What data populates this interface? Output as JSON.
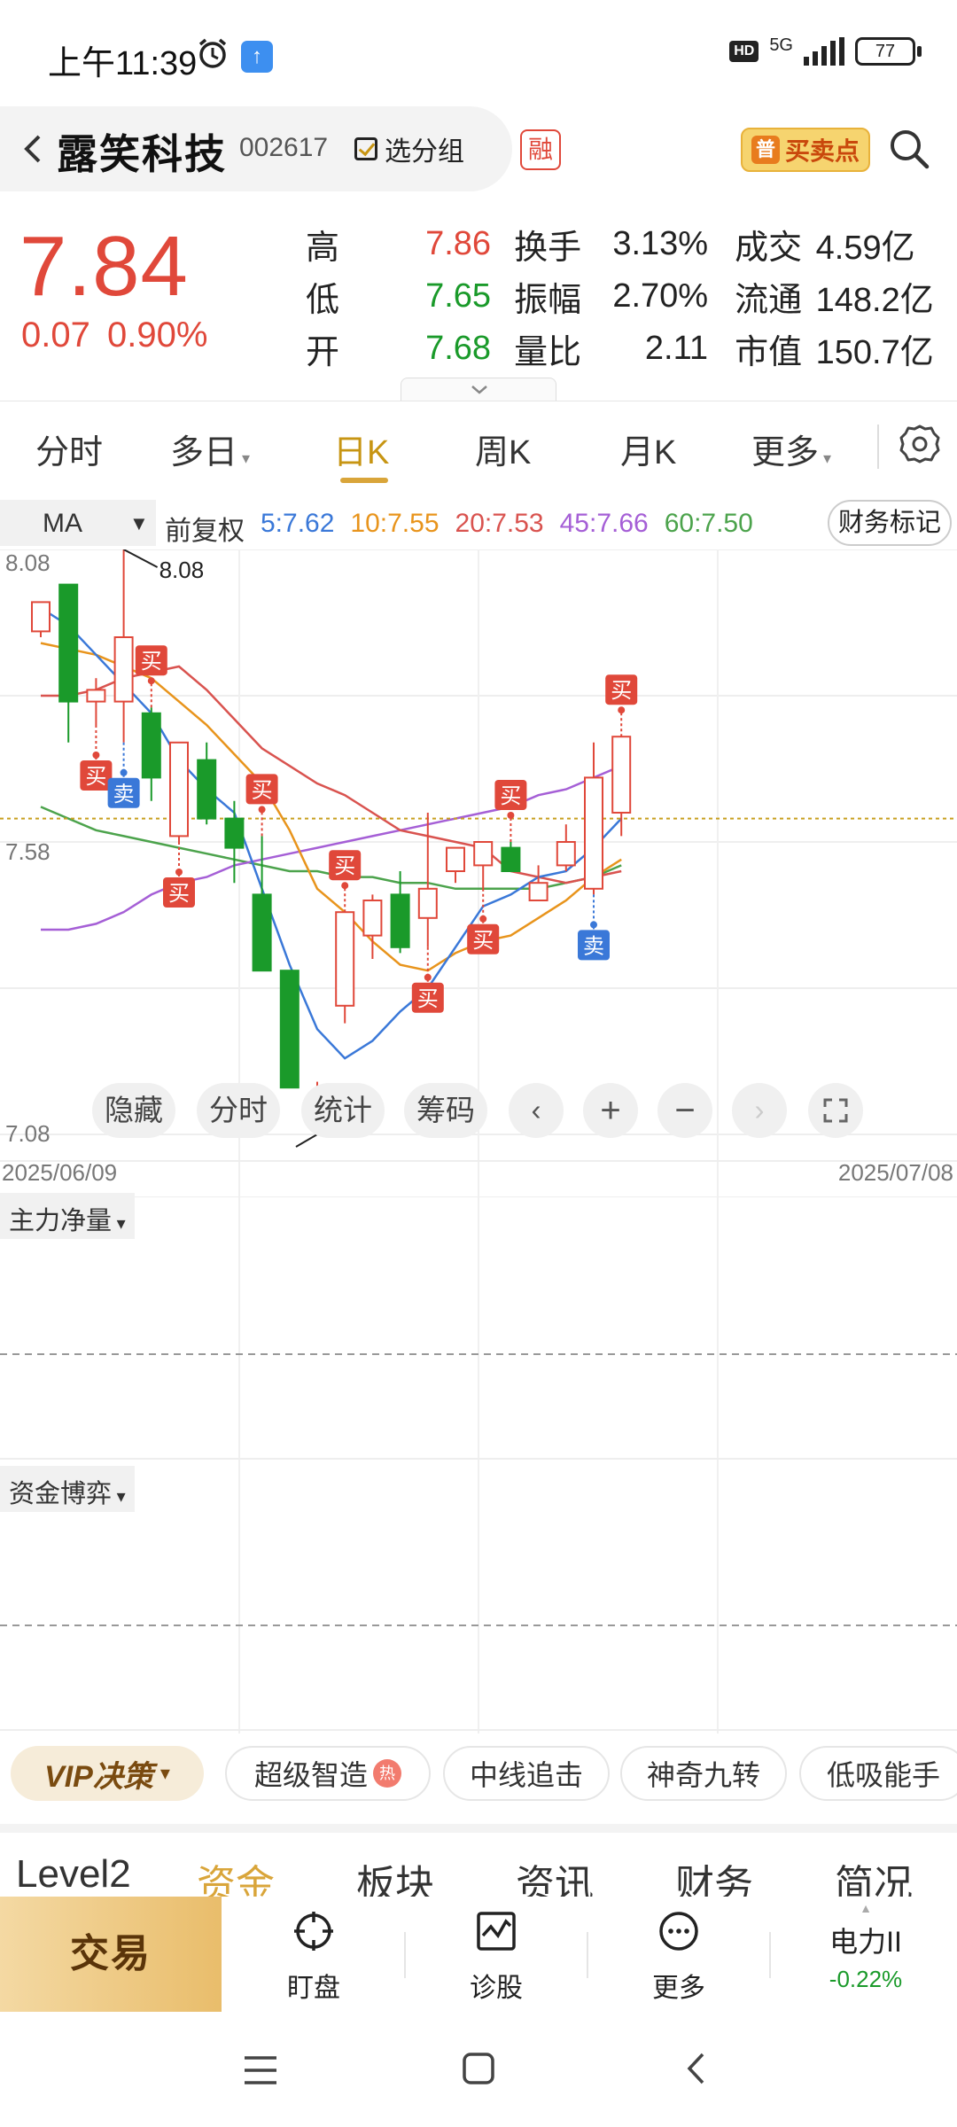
{
  "status": {
    "time": "上午11:39",
    "net": "5G",
    "hd": "HD",
    "battery": "77"
  },
  "header": {
    "name": "露笑科技",
    "code": "002617",
    "group_label": "选分组",
    "margin_badge": "融",
    "buysell_label": "买卖点",
    "buysell_badge": "普"
  },
  "quote": {
    "price": "7.84",
    "change": "0.07",
    "change_pct": "0.90%",
    "rows": [
      {
        "l1": "高",
        "v1": "7.86",
        "l2": "换手",
        "v2": "3.13%",
        "l3": "成交",
        "v3": "4.59亿"
      },
      {
        "l1": "低",
        "v1": "7.65",
        "l2": "振幅",
        "v2": "2.70%",
        "l3": "流通",
        "v3": "148.2亿"
      },
      {
        "l1": "开",
        "v1": "7.68",
        "l2": "量比",
        "v2": "2.11",
        "l3": "市值",
        "v3": "150.7亿"
      }
    ]
  },
  "period_tabs": [
    "分时",
    "多日",
    "日K",
    "周K",
    "月K",
    "更多"
  ],
  "active_period": "日K",
  "ma": {
    "selector": "MA",
    "adjust": "前复权",
    "items": [
      {
        "label": "5:7.62",
        "color": "#3a78d8"
      },
      {
        "label": "10:7.55",
        "color": "#e8941c"
      },
      {
        "label": "20:7.53",
        "color": "#d9534f"
      },
      {
        "label": "45:7.66",
        "color": "#a55fd6"
      },
      {
        "label": "60:7.50",
        "color": "#4ca34c"
      }
    ],
    "fin_mark": "财务标记"
  },
  "chart_data": {
    "type": "candlestick",
    "x_start": "2025/06/09",
    "x_end": "2025/07/08",
    "y_top_label": "8.08",
    "y_mid_label": "7.58",
    "y_bottom_label": "7.08",
    "high_marker": "8.08",
    "low_marker": "7.08",
    "ylim": [
      7.08,
      8.08
    ],
    "current_price_line": 7.62,
    "candles": [
      {
        "o": 7.94,
        "h": 7.99,
        "l": 7.93,
        "c": 7.99
      },
      {
        "o": 8.02,
        "h": 8.02,
        "l": 7.75,
        "c": 7.82
      },
      {
        "o": 7.82,
        "h": 7.86,
        "l": 7.78,
        "c": 7.84
      },
      {
        "o": 7.82,
        "h": 8.08,
        "l": 7.75,
        "c": 7.93
      },
      {
        "o": 7.8,
        "h": 7.81,
        "l": 7.65,
        "c": 7.69
      },
      {
        "o": 7.59,
        "h": 7.73,
        "l": 7.58,
        "c": 7.75
      },
      {
        "o": 7.72,
        "h": 7.75,
        "l": 7.61,
        "c": 7.62
      },
      {
        "o": 7.62,
        "h": 7.65,
        "l": 7.51,
        "c": 7.57
      },
      {
        "o": 7.49,
        "h": 7.59,
        "l": 7.42,
        "c": 7.36
      },
      {
        "o": 7.36,
        "h": 7.32,
        "l": 7.16,
        "c": 7.16
      },
      {
        "o": 7.11,
        "h": 7.17,
        "l": 7.08,
        "c": 7.14
      },
      {
        "o": 7.3,
        "h": 7.42,
        "l": 7.27,
        "c": 7.46
      },
      {
        "o": 7.42,
        "h": 7.49,
        "l": 7.38,
        "c": 7.48
      },
      {
        "o": 7.49,
        "h": 7.53,
        "l": 7.39,
        "c": 7.4
      },
      {
        "o": 7.45,
        "h": 7.63,
        "l": 7.4,
        "c": 7.5
      },
      {
        "o": 7.53,
        "h": 7.56,
        "l": 7.51,
        "c": 7.57
      },
      {
        "o": 7.54,
        "h": 7.57,
        "l": 7.5,
        "c": 7.58
      },
      {
        "o": 7.57,
        "h": 7.58,
        "l": 7.53,
        "c": 7.53
      },
      {
        "o": 7.48,
        "h": 7.54,
        "l": 7.48,
        "c": 7.51
      },
      {
        "o": 7.54,
        "h": 7.61,
        "l": 7.53,
        "c": 7.58
      },
      {
        "o": 7.5,
        "h": 7.75,
        "l": 7.49,
        "c": 7.69
      },
      {
        "o": 7.63,
        "h": 7.76,
        "l": 7.59,
        "c": 7.76
      }
    ],
    "ma5": [
      7.98,
      7.95,
      7.9,
      7.85,
      7.8,
      7.72,
      7.67,
      7.63,
      7.5,
      7.37,
      7.26,
      7.21,
      7.24,
      7.29,
      7.33,
      7.4,
      7.47,
      7.49,
      7.52,
      7.53,
      7.57,
      7.62
    ],
    "ma10": [
      7.92,
      7.91,
      7.9,
      7.88,
      7.86,
      7.82,
      7.78,
      7.73,
      7.68,
      7.6,
      7.5,
      7.46,
      7.41,
      7.37,
      7.36,
      7.39,
      7.41,
      7.42,
      7.45,
      7.48,
      7.52,
      7.55
    ],
    "ma20": [
      7.83,
      7.83,
      7.84,
      7.86,
      7.87,
      7.88,
      7.84,
      7.79,
      7.74,
      7.71,
      7.68,
      7.66,
      7.63,
      7.6,
      7.59,
      7.58,
      7.57,
      7.53,
      7.52,
      7.51,
      7.52,
      7.53
    ],
    "ma45": [
      7.43,
      7.43,
      7.44,
      7.46,
      7.49,
      7.51,
      7.52,
      7.54,
      7.55,
      7.56,
      7.57,
      7.58,
      7.59,
      7.6,
      7.61,
      7.62,
      7.63,
      7.64,
      7.66,
      7.67,
      7.69,
      7.71
    ],
    "ma60": [
      7.64,
      7.62,
      7.6,
      7.59,
      7.58,
      7.57,
      7.56,
      7.55,
      7.54,
      7.53,
      7.53,
      7.52,
      7.52,
      7.51,
      7.51,
      7.5,
      7.5,
      7.5,
      7.5,
      7.51,
      7.52,
      7.54
    ],
    "signals": [
      {
        "i": 2,
        "label": "买",
        "side": "buy",
        "pos": "below"
      },
      {
        "i": 3,
        "label": "卖",
        "side": "sell",
        "pos": "below"
      },
      {
        "i": 4,
        "label": "买",
        "side": "buy",
        "pos": "above"
      },
      {
        "i": 5,
        "label": "买",
        "side": "buy",
        "pos": "below"
      },
      {
        "i": 8,
        "label": "买",
        "side": "buy",
        "pos": "above"
      },
      {
        "i": 11,
        "label": "买",
        "side": "buy",
        "pos": "above"
      },
      {
        "i": 14,
        "label": "买",
        "side": "buy",
        "pos": "below"
      },
      {
        "i": 16,
        "label": "买",
        "side": "buy",
        "pos": "below"
      },
      {
        "i": 17,
        "label": "买",
        "side": "buy",
        "pos": "above"
      },
      {
        "i": 20,
        "label": "卖",
        "side": "sell",
        "pos": "below"
      },
      {
        "i": 21,
        "label": "买",
        "side": "buy",
        "pos": "above"
      }
    ]
  },
  "chart_controls": [
    "隐藏",
    "分时",
    "统计",
    "筹码"
  ],
  "panels": [
    {
      "title": "主力净量"
    },
    {
      "title": "资金博弈"
    }
  ],
  "features": {
    "vip": "VIP决策",
    "items": [
      "超级智造",
      "中线追击",
      "神奇九转",
      "低吸能手"
    ],
    "hot_badge": "热"
  },
  "bottom_tabs": [
    "Level2",
    "资金",
    "板块",
    "资讯",
    "财务",
    "简况"
  ],
  "active_bottom_tab": "资金",
  "bottom_bar": {
    "trade": "交易",
    "items": [
      "盯盘",
      "诊股",
      "更多"
    ],
    "index_name": "电力II",
    "index_change": "-0.22%"
  },
  "colors": {
    "up": "#e0483a",
    "down": "#1a9a2a",
    "accent": "#d9a53a",
    "sell_marker": "#3a78d8"
  }
}
